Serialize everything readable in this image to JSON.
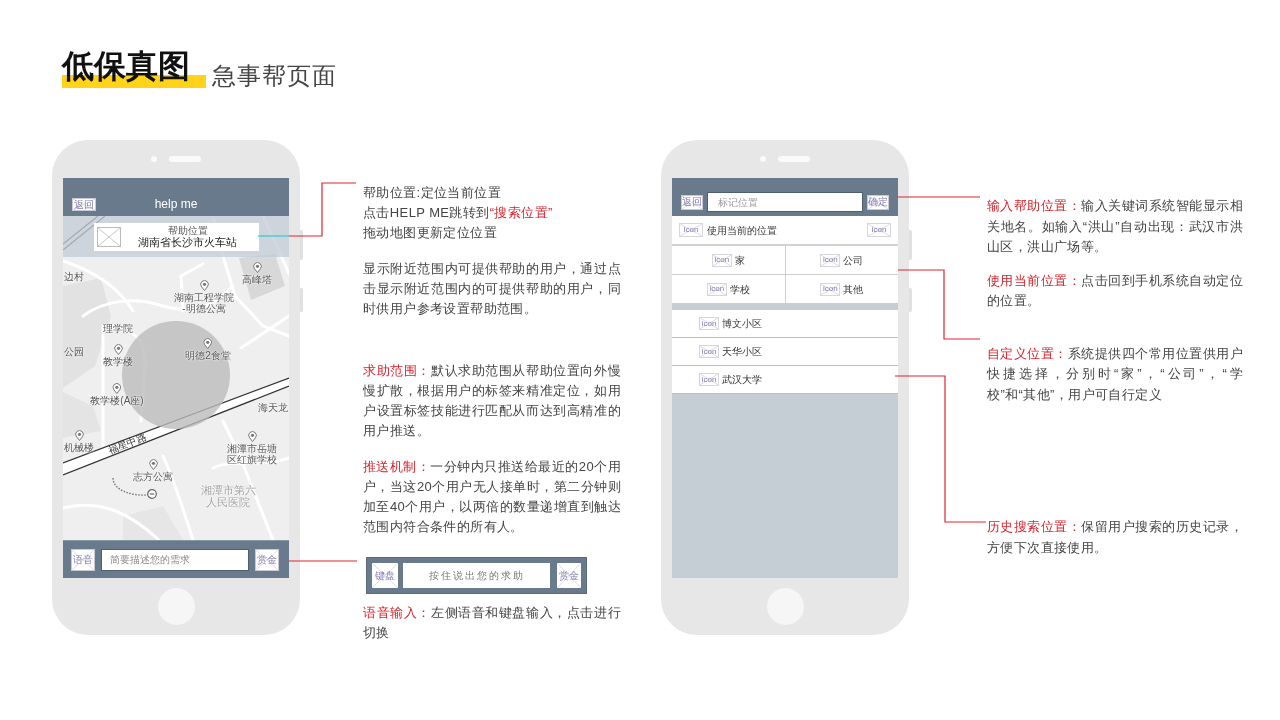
{
  "title": {
    "main": "低保真图",
    "sub": "急事帮页面"
  },
  "help_phone": {
    "header": {
      "back_button": "返回",
      "title": "help me"
    },
    "location_card": {
      "label": "帮助位置",
      "address": "湖南省长沙市火车站"
    },
    "map_labels": [
      {
        "kind": "area",
        "lines": [
          "边村"
        ]
      },
      {
        "kind": "poi",
        "lines": [
          "高峰塔"
        ]
      },
      {
        "kind": "poi",
        "lines": [
          "湖南工程学院",
          "-明德公寓"
        ]
      },
      {
        "kind": "area",
        "lines": [
          "理学院"
        ]
      },
      {
        "kind": "area",
        "lines": [
          "公园"
        ]
      },
      {
        "kind": "poi",
        "lines": [
          "教学楼"
        ]
      },
      {
        "kind": "poi",
        "lines": [
          "明德2食堂"
        ]
      },
      {
        "kind": "poi",
        "lines": [
          "教学楼(A座)"
        ]
      },
      {
        "kind": "area",
        "lines": [
          "海天龙"
        ]
      },
      {
        "kind": "road",
        "lines": [
          "福星中路"
        ]
      },
      {
        "kind": "poi",
        "lines": [
          "机械楼"
        ]
      },
      {
        "kind": "poi",
        "lines": [
          "湘潭市岳塘",
          "区红旗学校"
        ]
      },
      {
        "kind": "poi",
        "lines": [
          "志方公寓"
        ]
      },
      {
        "kind": "landmark",
        "lines": [
          "湘潭市第六",
          "人民医院"
        ]
      }
    ],
    "bottom_bar": {
      "voice_button": "语音",
      "request_input": {
        "placeholder": "简要描述您的需求"
      },
      "reward_button": "赏金"
    }
  },
  "help_notes": [
    {
      "paragraphs": [
        [
          {
            "text": "帮助位置:定位当前位置",
            "highlight": false
          }
        ],
        [
          {
            "text": "点击HELP ME跳转到",
            "highlight": false
          },
          {
            "text": "“搜索位置”",
            "highlight": true
          }
        ],
        [
          {
            "text": "拖动地图更新定位位置",
            "highlight": false
          }
        ]
      ]
    },
    {
      "paragraphs": [
        [
          {
            "text": "显示附近范围内可提供帮助的用户，通过点击显示附近范围内的可提供帮助的用户，同时供用户参考设置帮助范围。",
            "highlight": false
          }
        ]
      ]
    },
    {
      "paragraphs": [
        [
          {
            "text": "求助范围：",
            "highlight": true
          },
          {
            "text": "默认求助范围从帮助位置向外慢慢扩散，根据用户的标签来精准定位，如用户设置标签技能进行匹配从而达到高精准的用户推送。",
            "highlight": false
          }
        ]
      ]
    },
    {
      "paragraphs": [
        [
          {
            "text": "推送机制：",
            "highlight": true
          },
          {
            "text": "一分钟内只推送给最近的20个用户，当这20个用户无人接单时，第二分钟则加至40个用户，以两倍的数量递增直到触达范围内符合条件的所有人。",
            "highlight": false
          }
        ]
      ]
    }
  ],
  "voice_bar": {
    "keyboard_button": "键盘",
    "hold_button": "按住说出您的求助",
    "reward_button": "赏金"
  },
  "voice_note": {
    "paragraphs": [
      [
        {
          "text": "语音输入：",
          "highlight": true
        },
        {
          "text": "左侧语音和键盘输入，点击进行切换",
          "highlight": false
        }
      ]
    ]
  },
  "search_phone": {
    "header": {
      "back_button": "返回",
      "search_input": {
        "placeholder": "标记位置"
      },
      "confirm_button": "确定"
    },
    "current_location": {
      "icon": "icon",
      "label": "使用当前的位置",
      "trailing_icon": "icon"
    },
    "shortcuts": [
      {
        "icon": "icon",
        "label": "家"
      },
      {
        "icon": "icon",
        "label": "公司"
      },
      {
        "icon": "icon",
        "label": "学校"
      },
      {
        "icon": "icon",
        "label": "其他"
      }
    ],
    "history": [
      {
        "icon": "icon",
        "label": "博文小区"
      },
      {
        "icon": "icon",
        "label": "天华小区"
      },
      {
        "icon": "icon",
        "label": "武汉大学"
      }
    ]
  },
  "search_notes": [
    {
      "paragraphs": [
        [
          {
            "text": "输入帮助位置：",
            "highlight": true
          },
          {
            "text": "输入关键词系统智能显示相关地名。如输入“洪山”自动出现：武汉市洪山区，洪山广场等。",
            "highlight": false
          }
        ]
      ]
    },
    {
      "paragraphs": [
        [
          {
            "text": "使用当前位置：",
            "highlight": true
          },
          {
            "text": "点击回到手机系统自动定位的位置。",
            "highlight": false
          }
        ]
      ]
    },
    {
      "paragraphs": [
        [
          {
            "text": "自定义位置：",
            "highlight": true
          },
          {
            "text": "系统提供四个常用位置供用户快捷选择，分别时“家”，“公司”，“学校”和“其他”，用户可自行定义",
            "highlight": false
          }
        ]
      ]
    },
    {
      "paragraphs": [
        [
          {
            "text": "历史搜索位置：",
            "highlight": true
          },
          {
            "text": "保留用户搜索的历史记录，方便下次直接使用。",
            "highlight": false
          }
        ]
      ]
    }
  ]
}
